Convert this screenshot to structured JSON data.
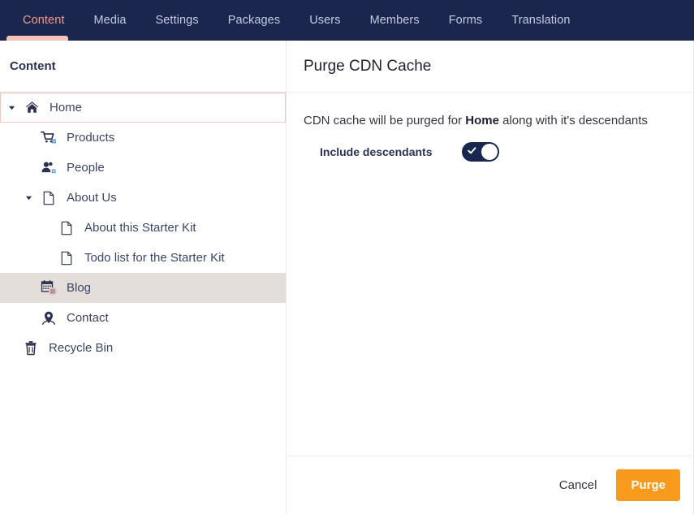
{
  "topnav": {
    "tabs": [
      {
        "label": "Content",
        "active": true
      },
      {
        "label": "Media",
        "active": false
      },
      {
        "label": "Settings",
        "active": false
      },
      {
        "label": "Packages",
        "active": false
      },
      {
        "label": "Users",
        "active": false
      },
      {
        "label": "Members",
        "active": false
      },
      {
        "label": "Forms",
        "active": false
      },
      {
        "label": "Translation",
        "active": false
      }
    ],
    "background_color": "#1b264f",
    "active_color": "#f09a8a",
    "inactive_color": "#c5cbe0",
    "indicator_color": "#f5c3b8"
  },
  "tree": {
    "header_title": "Content",
    "items": [
      {
        "label": "Home",
        "icon": "home-icon",
        "level": 0,
        "caret": "expanded",
        "state": "selected-outline"
      },
      {
        "label": "Products",
        "icon": "cart-icon",
        "level": 1,
        "caret": "none",
        "state": "normal"
      },
      {
        "label": "People",
        "icon": "people-icon",
        "level": 1,
        "caret": "none",
        "state": "normal"
      },
      {
        "label": "About Us",
        "icon": "document-icon",
        "level": 1,
        "caret": "expanded",
        "state": "normal"
      },
      {
        "label": "About this Starter Kit",
        "icon": "document-icon",
        "level": 2,
        "caret": "none",
        "state": "normal"
      },
      {
        "label": "Todo list for the Starter Kit",
        "icon": "document-icon",
        "level": 2,
        "caret": "none",
        "state": "normal"
      },
      {
        "label": "Blog",
        "icon": "calendar-icon",
        "level": 1,
        "caret": "none",
        "state": "highlight"
      },
      {
        "label": "Contact",
        "icon": "map-pin-icon",
        "level": 1,
        "caret": "none",
        "state": "normal"
      },
      {
        "label": "Recycle Bin",
        "icon": "trash-icon",
        "level": 0,
        "caret": "none",
        "state": "normal"
      }
    ],
    "selected_border_color": "#f3c7bd",
    "highlight_background": "#e3ded9"
  },
  "panel": {
    "title": "Purge CDN Cache",
    "description_prefix": "CDN cache will be purged for ",
    "description_target": "Home",
    "description_suffix": " along with it's descendants",
    "toggle_label": "Include descendants",
    "toggle_state": "on",
    "toggle_on_color": "#1b264f"
  },
  "footer": {
    "cancel_label": "Cancel",
    "purge_label": "Purge",
    "purge_color": "#f89a1c"
  }
}
